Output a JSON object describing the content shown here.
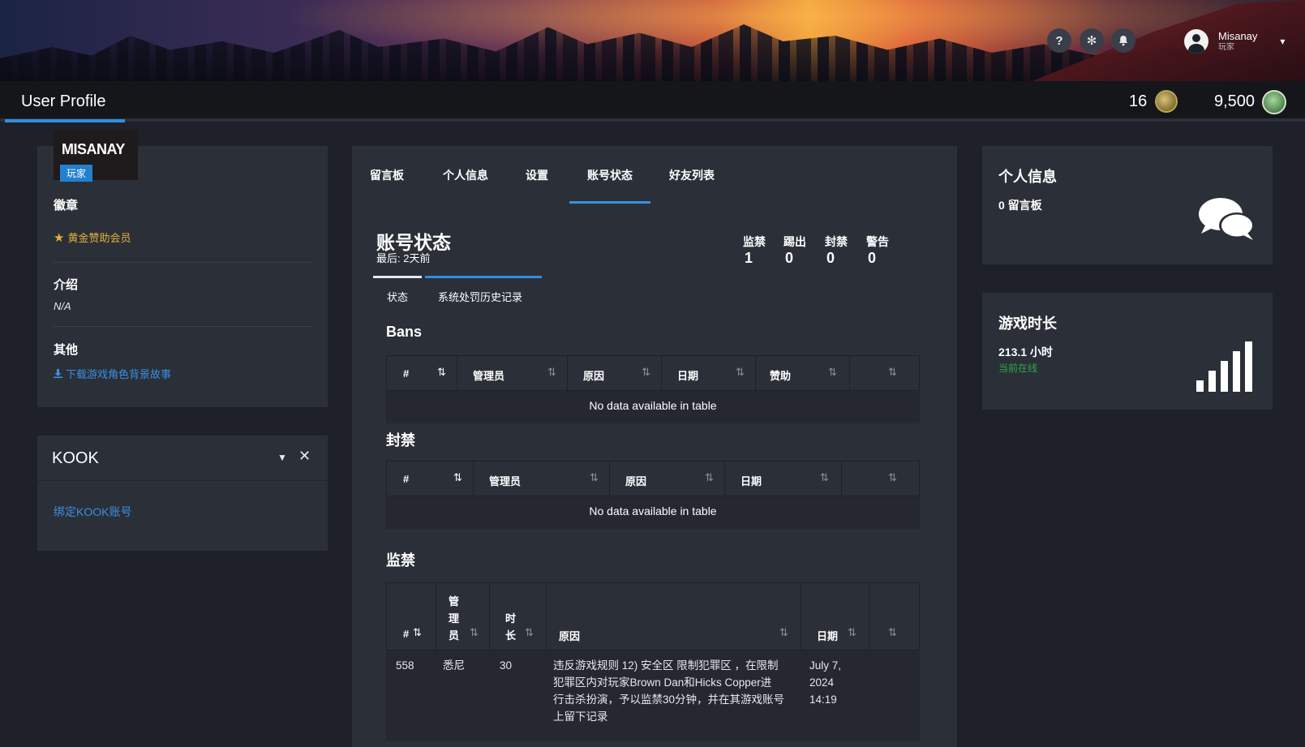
{
  "header": {
    "help_icon": "question-icon",
    "settings_icon": "gear-icon",
    "notify_icon": "bell-icon",
    "user_name": "Misanay",
    "user_role": "玩家"
  },
  "titlebar": {
    "page_title": "User Profile",
    "medal_count": "16",
    "coin_count": "9,500"
  },
  "profile": {
    "name": "MISANAY",
    "role_badge": "玩家",
    "badges_label": "徽章",
    "badge_item": "黄金赞助会员",
    "intro_label": "介绍",
    "intro_value": "N/A",
    "other_label": "其他",
    "download_link": "下载游戏角色背景故事"
  },
  "kook": {
    "title": "KOOK",
    "bind_link": "绑定KOOK账号"
  },
  "tabs": [
    "留言板",
    "个人信息",
    "设置",
    "账号状态",
    "好友列表"
  ],
  "account_status": {
    "title": "账号状态",
    "last_seen": "最后: 2天前",
    "counts": [
      {
        "label": "监禁",
        "value": "1"
      },
      {
        "label": "踢出",
        "value": "0"
      },
      {
        "label": "封禁",
        "value": "0"
      },
      {
        "label": "警告",
        "value": "0"
      }
    ],
    "subtabs": [
      "状态",
      "系统处罚历史记录"
    ]
  },
  "bans_table": {
    "title": "Bans",
    "columns": [
      "#",
      "管理员",
      "原因",
      "日期",
      "赞助"
    ],
    "empty": "No data available in table"
  },
  "bans2_table": {
    "title": "封禁",
    "columns": [
      "#",
      "管理员",
      "原因",
      "日期"
    ],
    "empty": "No data available in table"
  },
  "jail_table": {
    "title": "监禁",
    "columns": [
      "#",
      "管\n理\n员",
      "时\n长",
      "原因",
      "日期"
    ],
    "col_admin": [
      "管",
      "理",
      "员"
    ],
    "col_duration": [
      "时",
      "长"
    ],
    "rows": [
      {
        "id": "558",
        "admin": "悉尼",
        "duration": "30",
        "reason_lines": [
          "违反游戏规则 12) 安全区 限制犯罪区 ，在限制",
          "犯罪区内对玩家Brown Dan和Hicks Copper进",
          "行击杀扮演，予以监禁30分钟，并在其游戏账号",
          "上留下记录"
        ],
        "date_lines": [
          "July 7,",
          "2024",
          "14:19"
        ]
      }
    ]
  },
  "side_info": {
    "title": "个人信息",
    "messages": "0 留言板",
    "icon": "chat-bubbles-icon"
  },
  "side_playtime": {
    "title": "游戏时长",
    "hours": "213.1 小时",
    "status": "当前在线",
    "icon": "signal-bars-icon"
  }
}
